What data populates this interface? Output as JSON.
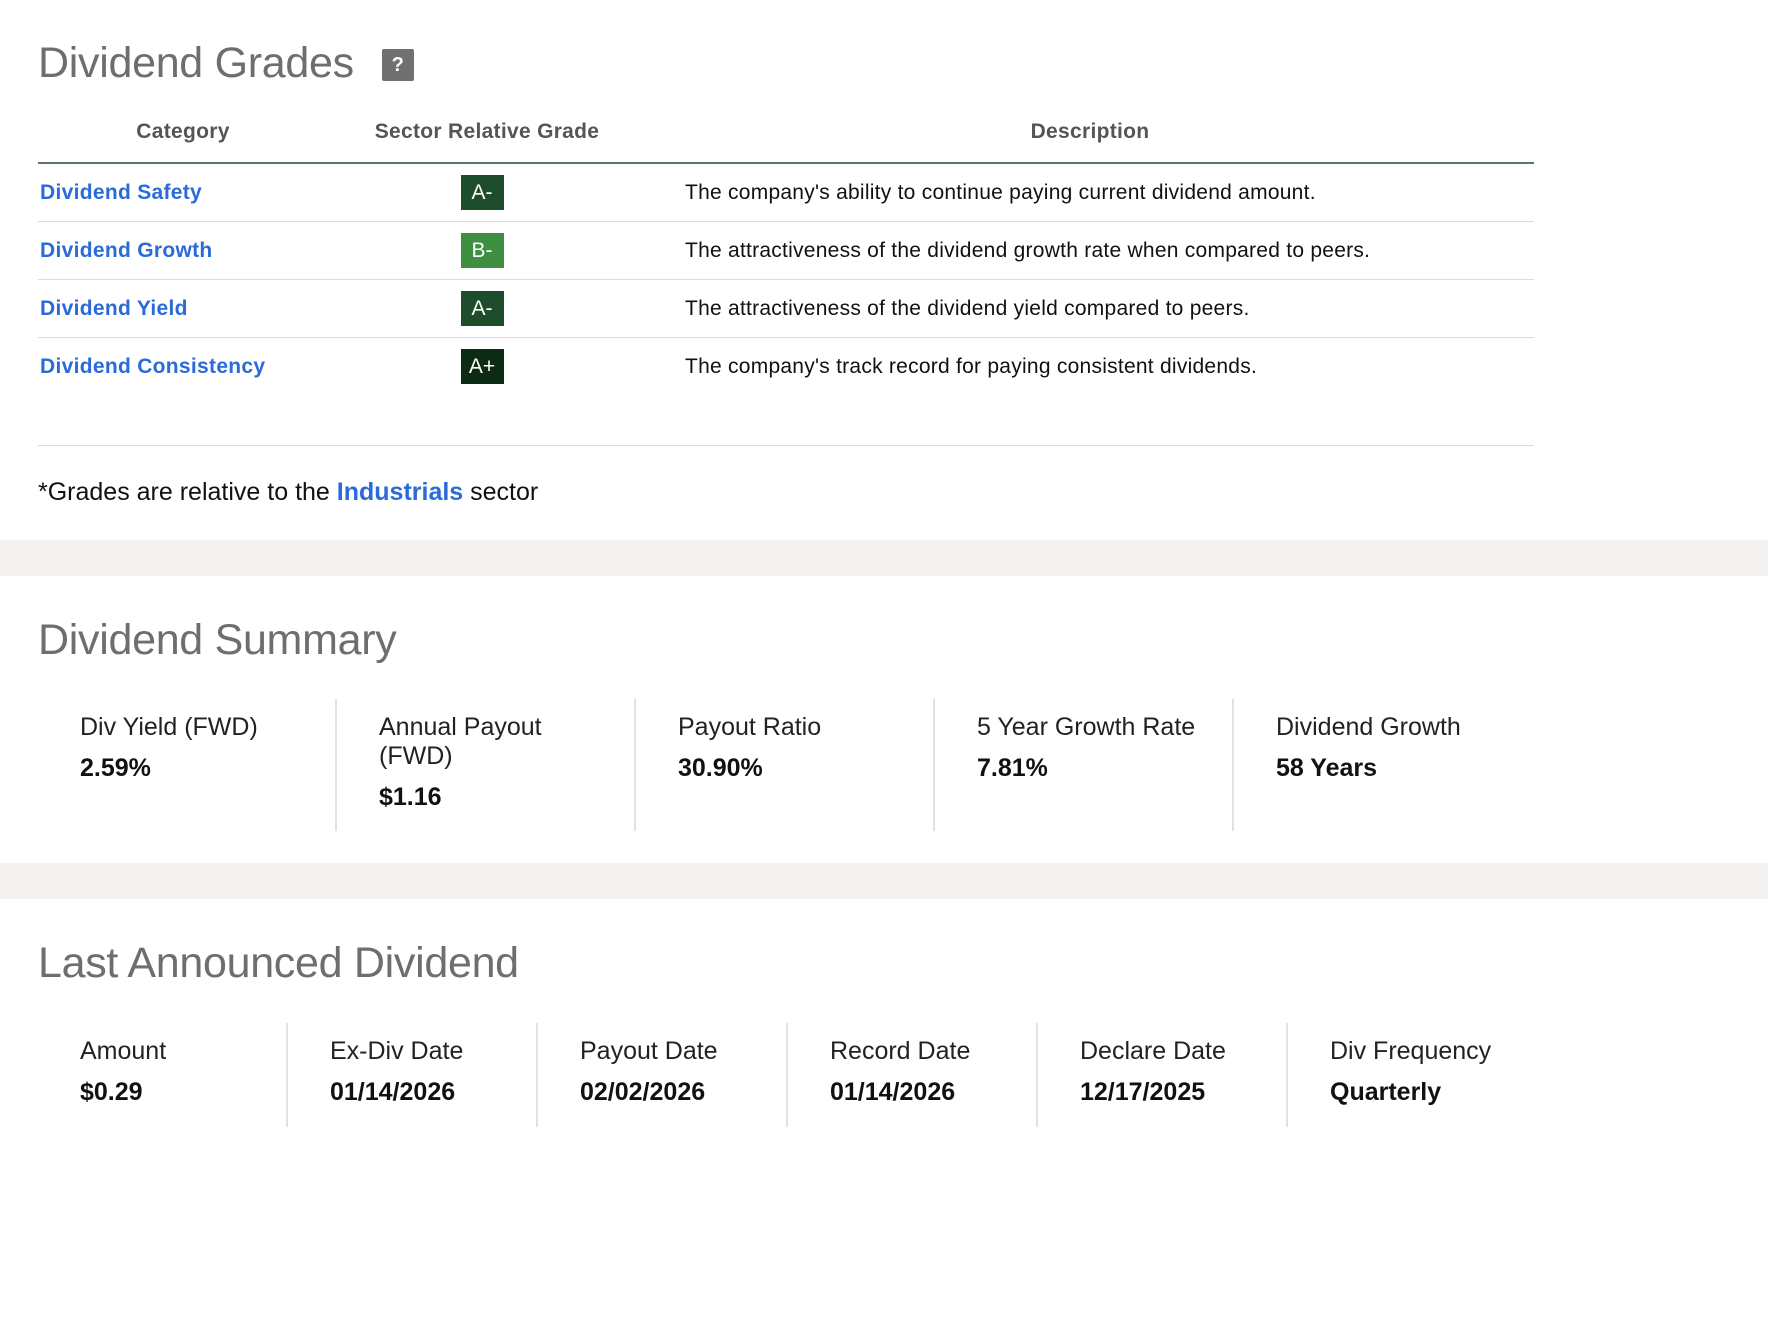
{
  "grades": {
    "title": "Dividend Grades",
    "help_label": "?",
    "headers": {
      "category": "Category",
      "grade": "Sector Relative Grade",
      "description": "Description"
    },
    "rows": [
      {
        "category": "Dividend Safety",
        "grade": "A-",
        "color": "#1e4d2b",
        "description": "The company's ability to continue paying current dividend amount."
      },
      {
        "category": "Dividend Growth",
        "grade": "B-",
        "color": "#3f8f43",
        "description": "The attractiveness of the dividend growth rate when compared to peers."
      },
      {
        "category": "Dividend Yield",
        "grade": "A-",
        "color": "#1e4d2b",
        "description": "The attractiveness of the dividend yield compared to peers."
      },
      {
        "category": "Dividend Consistency",
        "grade": "A+",
        "color": "#0b2b12",
        "description": "The company's track record for paying consistent dividends."
      }
    ],
    "footnote_prefix": "*Grades are relative to the ",
    "footnote_link": "Industrials",
    "footnote_suffix": " sector"
  },
  "summary": {
    "title": "Dividend Summary",
    "metrics": [
      {
        "label": "Div Yield (FWD)",
        "value": "2.59%"
      },
      {
        "label": "Annual Payout (FWD)",
        "value": "$1.16"
      },
      {
        "label": "Payout Ratio",
        "value": "30.90%"
      },
      {
        "label": "5 Year Growth Rate",
        "value": "7.81%"
      },
      {
        "label": "Dividend Growth",
        "value": "58 Years"
      }
    ]
  },
  "last_dividend": {
    "title": "Last Announced Dividend",
    "metrics": [
      {
        "label": "Amount",
        "value": "$0.29"
      },
      {
        "label": "Ex-Div Date",
        "value": "01/14/2026"
      },
      {
        "label": "Payout Date",
        "value": "02/02/2026"
      },
      {
        "label": "Record Date",
        "value": "01/14/2026"
      },
      {
        "label": "Declare Date",
        "value": "12/17/2025"
      },
      {
        "label": "Div Frequency",
        "value": "Quarterly"
      }
    ]
  }
}
